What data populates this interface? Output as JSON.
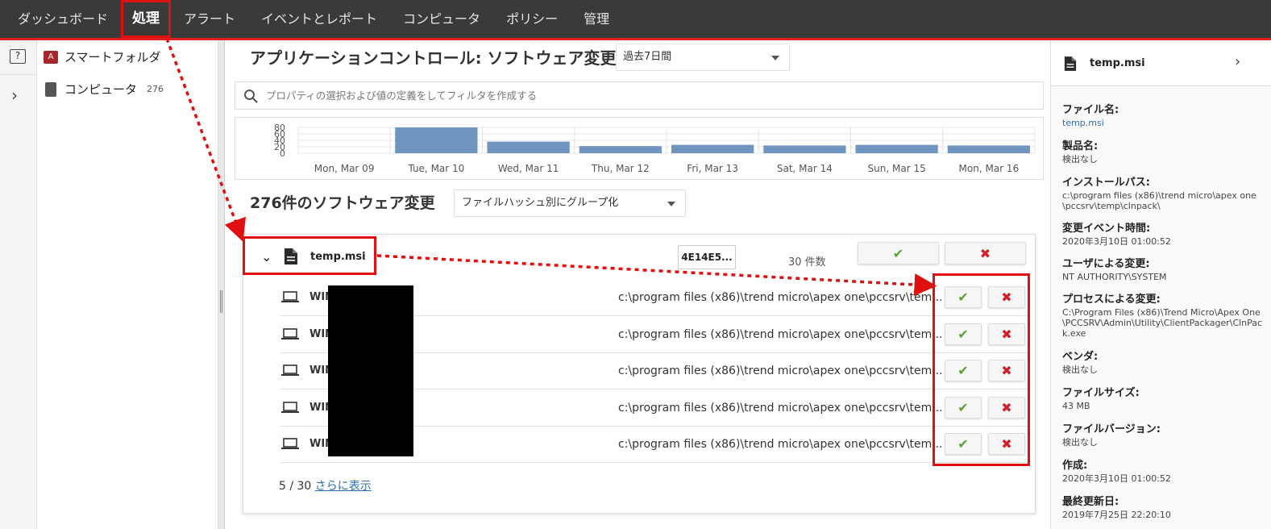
{
  "nav": {
    "items": [
      "ダッシュボード",
      "処理",
      "アラート",
      "イベントとレポート",
      "コンピュータ",
      "ポリシー",
      "管理"
    ],
    "active": "処理"
  },
  "rail": {
    "help_label": "?",
    "expand_label": "›"
  },
  "sidebar": {
    "items": [
      {
        "label": "スマートフォルダ",
        "icon": "smart-folder-icon"
      },
      {
        "label": "コンピュータ",
        "count": "276",
        "icon": "computer-icon"
      }
    ]
  },
  "main": {
    "title": "アプリケーションコントロール: ソフトウェア変更",
    "period": "過去7日間",
    "filter_placeholder": "プロパティの選択および値の定義をしてフィルタを作成する",
    "list_title": "276件のソフトウェア変更",
    "group_by": "ファイルハッシュ別にグループ化"
  },
  "chart_data": {
    "type": "bar",
    "categories": [
      "Mon, Mar 09",
      "Tue, Mar 10",
      "Wed, Mar 11",
      "Thu, Mar 12",
      "Fri, Mar 13",
      "Sat, Mar 14",
      "Sun, Mar 15",
      "Mon, Mar 16"
    ],
    "values": [
      0,
      80,
      36,
      22,
      26,
      24,
      26,
      24
    ],
    "yticks": [
      "80",
      "60",
      "40",
      "20",
      "0"
    ],
    "ylim": [
      0,
      80
    ],
    "bar_color": "#7096bf",
    "grid": true
  },
  "group": {
    "file_name": "temp.msi",
    "hash": "4E14E5...",
    "count": "30 件数",
    "rows": [
      {
        "host": "WIN",
        "path": "c:\\program files (x86)\\trend micro\\apex one\\pccsrv\\tem..."
      },
      {
        "host": "WIN",
        "path": "c:\\program files (x86)\\trend micro\\apex one\\pccsrv\\tem..."
      },
      {
        "host": "WIN",
        "path": "c:\\program files (x86)\\trend micro\\apex one\\pccsrv\\tem..."
      },
      {
        "host": "WIN",
        "path": "c:\\program files (x86)\\trend micro\\apex one\\pccsrv\\tem..."
      },
      {
        "host": "WIN",
        "path": "c:\\program files (x86)\\trend micro\\apex one\\pccsrv\\tem..."
      }
    ],
    "pager_count": "5 / 30",
    "more_label": "さらに表示",
    "approve_symbol": "✔",
    "block_symbol": "✖"
  },
  "details": {
    "title": "temp.msi",
    "fields": [
      {
        "label": "ファイル名:",
        "value": "temp.msi",
        "link": true
      },
      {
        "label": "製品名:",
        "value": "検出なし"
      },
      {
        "label": "インストールパス:",
        "value": "c:\\program files (x86)\\trend micro\\apex one\\pccsrv\\temp\\clnpack\\"
      },
      {
        "label": "変更イベント時間:",
        "value": "2020年3月10日 01:00:52"
      },
      {
        "label": "ユーザによる変更:",
        "value": "NT AUTHORITY\\SYSTEM"
      },
      {
        "label": "プロセスによる変更:",
        "value": "C:\\Program Files (x86)\\Trend Micro\\Apex One\\PCCSRV\\Admin\\Utility\\ClientPackager\\ClnPack.exe"
      },
      {
        "label": "ベンダ:",
        "value": "検出なし"
      },
      {
        "label": "ファイルサイズ:",
        "value": "43 MB"
      },
      {
        "label": "ファイルバージョン:",
        "value": "検出なし"
      },
      {
        "label": "作成:",
        "value": "2020年3月10日 01:00:52"
      },
      {
        "label": "最終更新日:",
        "value": "2019年7月25日 22:20:10"
      }
    ]
  },
  "colors": {
    "accent_red": "#e01010",
    "approve_green": "#5aa234",
    "block_red": "#d0202a",
    "link_blue": "#2a6fb7"
  }
}
